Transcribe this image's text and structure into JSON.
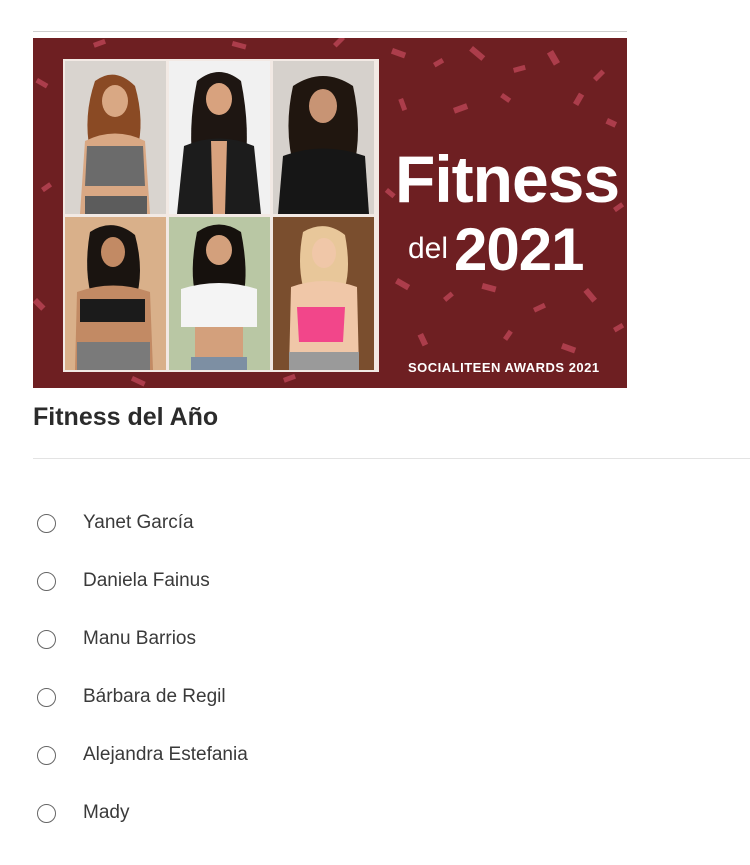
{
  "banner": {
    "title": "Fitness",
    "subtitle_small": "del",
    "subtitle_year": "2021",
    "footer": "SOCIALITEEN AWARDS 2021",
    "background_color": "#6e1f22",
    "confetti_color": "#c2485a",
    "photos": [
      {
        "name": "photo-woman-1"
      },
      {
        "name": "photo-woman-2"
      },
      {
        "name": "photo-woman-3"
      },
      {
        "name": "photo-woman-4"
      },
      {
        "name": "photo-woman-5"
      },
      {
        "name": "photo-woman-6"
      }
    ]
  },
  "question": {
    "title": "Fitness del Año",
    "options": [
      {
        "label": "Yanet García",
        "selected": false
      },
      {
        "label": "Daniela Fainus",
        "selected": false
      },
      {
        "label": "Manu Barrios",
        "selected": false
      },
      {
        "label": "Bárbara de Regil",
        "selected": false
      },
      {
        "label": "Alejandra Estefania",
        "selected": false
      },
      {
        "label": "Mady",
        "selected": false
      }
    ]
  }
}
